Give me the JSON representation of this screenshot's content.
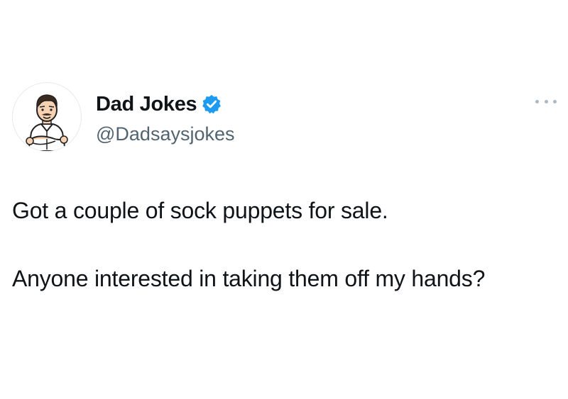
{
  "author": {
    "display_name": "Dad Jokes",
    "handle": "@Dadsaysjokes",
    "verified": true,
    "avatar_icon": "cartoon-dad-avatar-icon",
    "verified_icon": "verified-badge-icon",
    "verified_color": "#1d9bf0"
  },
  "menu": {
    "icon": "more-options-icon"
  },
  "tweet": {
    "paragraphs": [
      "Got a couple of sock puppets for sale.",
      "Anyone interested in taking them off my hands?"
    ]
  },
  "colors": {
    "text": "#0f1419",
    "secondary_text": "#536471",
    "background": "#ffffff"
  }
}
